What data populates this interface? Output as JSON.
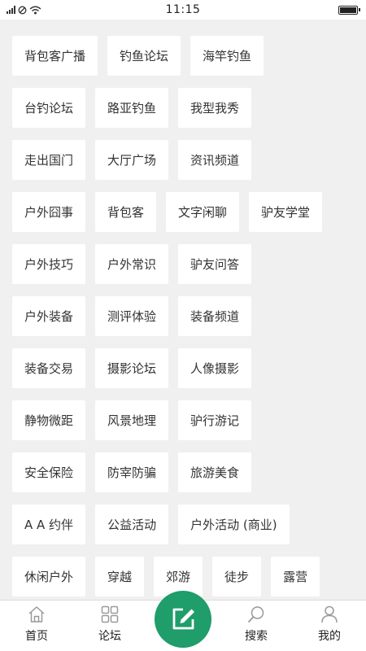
{
  "status_bar": {
    "time": "11:15"
  },
  "tag_rows": [
    [
      "背包客广播",
      "钓鱼论坛",
      "海竿钓鱼"
    ],
    [
      "台钓论坛",
      "路亚钓鱼",
      "我型我秀"
    ],
    [
      "走出国门",
      "大厅广场",
      "资讯频道"
    ],
    [
      "户外囧事",
      "背包客",
      "文字闲聊",
      "驴友学堂"
    ],
    [
      "户外技巧",
      "户外常识",
      "驴友问答"
    ],
    [
      "户外装备",
      "测评体验",
      "装备频道"
    ],
    [
      "装备交易",
      "摄影论坛",
      "人像摄影"
    ],
    [
      "静物微距",
      "风景地理",
      "驴行游记"
    ],
    [
      "安全保险",
      "防宰防骗",
      "旅游美食"
    ],
    [
      "A A 约伴",
      "公益活动",
      "户外活动 (商业)"
    ],
    [
      "休闲户外",
      "穿越",
      "郊游",
      "徒步",
      "露营"
    ]
  ],
  "bottom_nav": {
    "home": {
      "label": "首页",
      "icon": "home-icon"
    },
    "forum": {
      "label": "论坛",
      "icon": "grid-icon"
    },
    "compose": {
      "icon": "edit-icon"
    },
    "search": {
      "label": "搜索",
      "icon": "search-icon"
    },
    "mine": {
      "label": "我的",
      "icon": "user-icon"
    }
  },
  "colors": {
    "accent": "#1f9d6b",
    "background": "#f0f0f0",
    "tag_bg": "#ffffff",
    "text": "#333333"
  }
}
